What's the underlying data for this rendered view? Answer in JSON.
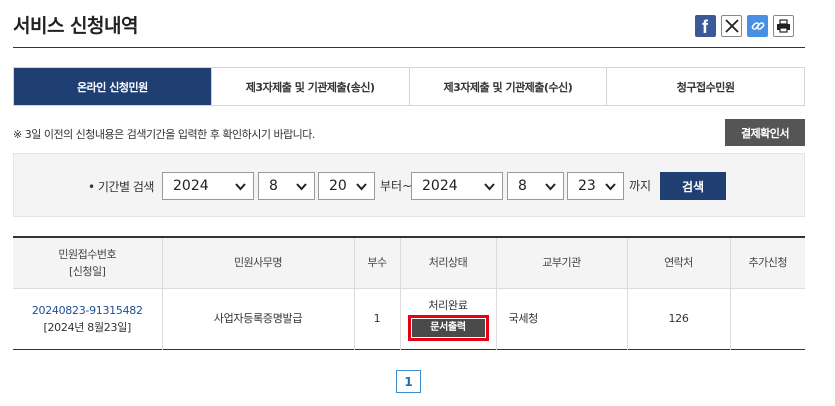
{
  "page": {
    "title": "서비스 신청내역"
  },
  "share": [
    {
      "name": "facebook-icon",
      "color": "#3b5998"
    },
    {
      "name": "x-icon",
      "color": "#ffffff"
    },
    {
      "name": "link-icon",
      "color": "#4a90e2"
    },
    {
      "name": "print-icon",
      "color": "#ffffff"
    }
  ],
  "tabs": [
    {
      "label": "온라인 신청민원",
      "active": true
    },
    {
      "label": "제3자제출 및 기관제출(송신)",
      "active": false
    },
    {
      "label": "제3자제출 및 기관제출(수신)",
      "active": false
    },
    {
      "label": "청구접수민원",
      "active": false
    }
  ],
  "notice": "※ 3일 이전의 신청내용은 검색기간을 입력한 후 확인하시기 바랍니다.",
  "confirm_button": "결제확인서",
  "search": {
    "label": "• 기간별 검색",
    "from_year": "2024",
    "from_month": "8",
    "from_day": "20",
    "from_word": "부터~",
    "to_year": "2024",
    "to_month": "8",
    "to_day": "23",
    "to_word": "까지",
    "button": "검색"
  },
  "table": {
    "headers": {
      "receipt_no_line1": "민원접수번호",
      "receipt_no_line2": "[신청일]",
      "task": "민원사무명",
      "copies": "부수",
      "status": "처리상태",
      "agency": "교부기관",
      "contact": "연락처",
      "extra": "추가신청"
    },
    "rows": [
      {
        "receipt_no": "20240823-91315482",
        "date": "[2024년 8월23일]",
        "task": "사업자등록증명발급",
        "copies": "1",
        "status": "처리완료",
        "print_button": "문서출력",
        "agency": "국세청",
        "contact": "126",
        "extra": ""
      }
    ]
  },
  "pagination": {
    "current": "1"
  },
  "colors": {
    "primary": "#1f3f72",
    "highlight": "#e60012",
    "link": "#1f4f94"
  }
}
